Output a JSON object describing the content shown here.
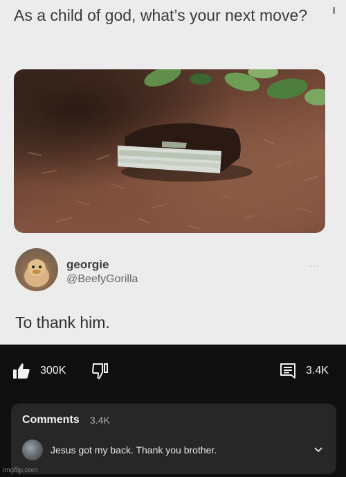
{
  "post": {
    "text": "As a child of god, what’s your next move?"
  },
  "reply": {
    "display_name": "georgie",
    "handle": "@BeefyGorilla",
    "text": "To thank him.",
    "more_label": "···"
  },
  "youtube": {
    "like_count": "300K",
    "comment_count": "3.4K",
    "comments_section": {
      "title": "Comments",
      "count": "3.4K",
      "top_comment": "Jesus got my back. Thank you brother."
    }
  },
  "watermark": "imgflip.com",
  "icons": {
    "like": "thumbs-up-icon",
    "dislike": "thumbs-down-icon",
    "comments": "comment-icon",
    "expand": "chevron-down-icon"
  },
  "colors": {
    "dark_bg": "#0f0f0f",
    "card_bg": "#272727",
    "light_bg": "#ececec"
  }
}
